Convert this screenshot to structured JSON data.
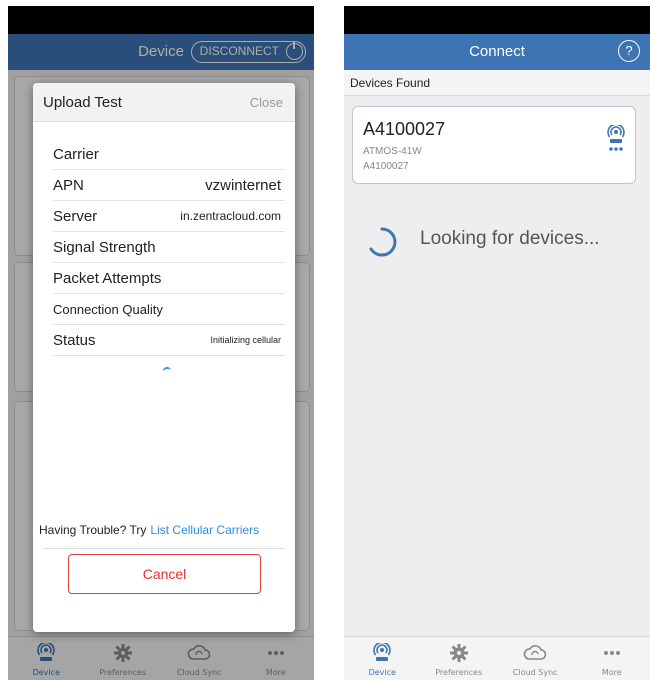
{
  "left": {
    "header_title": "Device",
    "disconnect_label": "DISCONNECT",
    "modal": {
      "title": "Upload Test",
      "close_label": "Close",
      "rows": [
        {
          "label": "Carrier",
          "value": ""
        },
        {
          "label": "APN",
          "value": "vzwinternet"
        },
        {
          "label": "Server",
          "value": "in.zentracloud.com"
        },
        {
          "label": "Signal Strength",
          "value": ""
        },
        {
          "label": "Packet Attempts",
          "value": ""
        },
        {
          "label": "Connection Quality",
          "value": ""
        },
        {
          "label": "Status",
          "value": "Initializing cellular"
        }
      ],
      "trouble_text": "Having Trouble? Try",
      "trouble_link": "List Cellular Carriers",
      "cancel_label": "Cancel"
    }
  },
  "right": {
    "header_title": "Connect",
    "help_label": "?",
    "devices_found_label": "Devices Found",
    "device": {
      "name": "A4100027",
      "model": "ATMOS-41W",
      "serial": "A4100027"
    },
    "loading_text": "Looking for devices..."
  },
  "tabs": [
    {
      "label": "Device",
      "icon": "device-icon"
    },
    {
      "label": "Preferences",
      "icon": "gear-icon"
    },
    {
      "label": "Cloud Sync",
      "icon": "cloud-sync-icon"
    },
    {
      "label": "More",
      "icon": "more-icon"
    }
  ],
  "colors": {
    "header": "#3d74b3",
    "link": "#2c8fe0",
    "cancel": "#e03030"
  }
}
